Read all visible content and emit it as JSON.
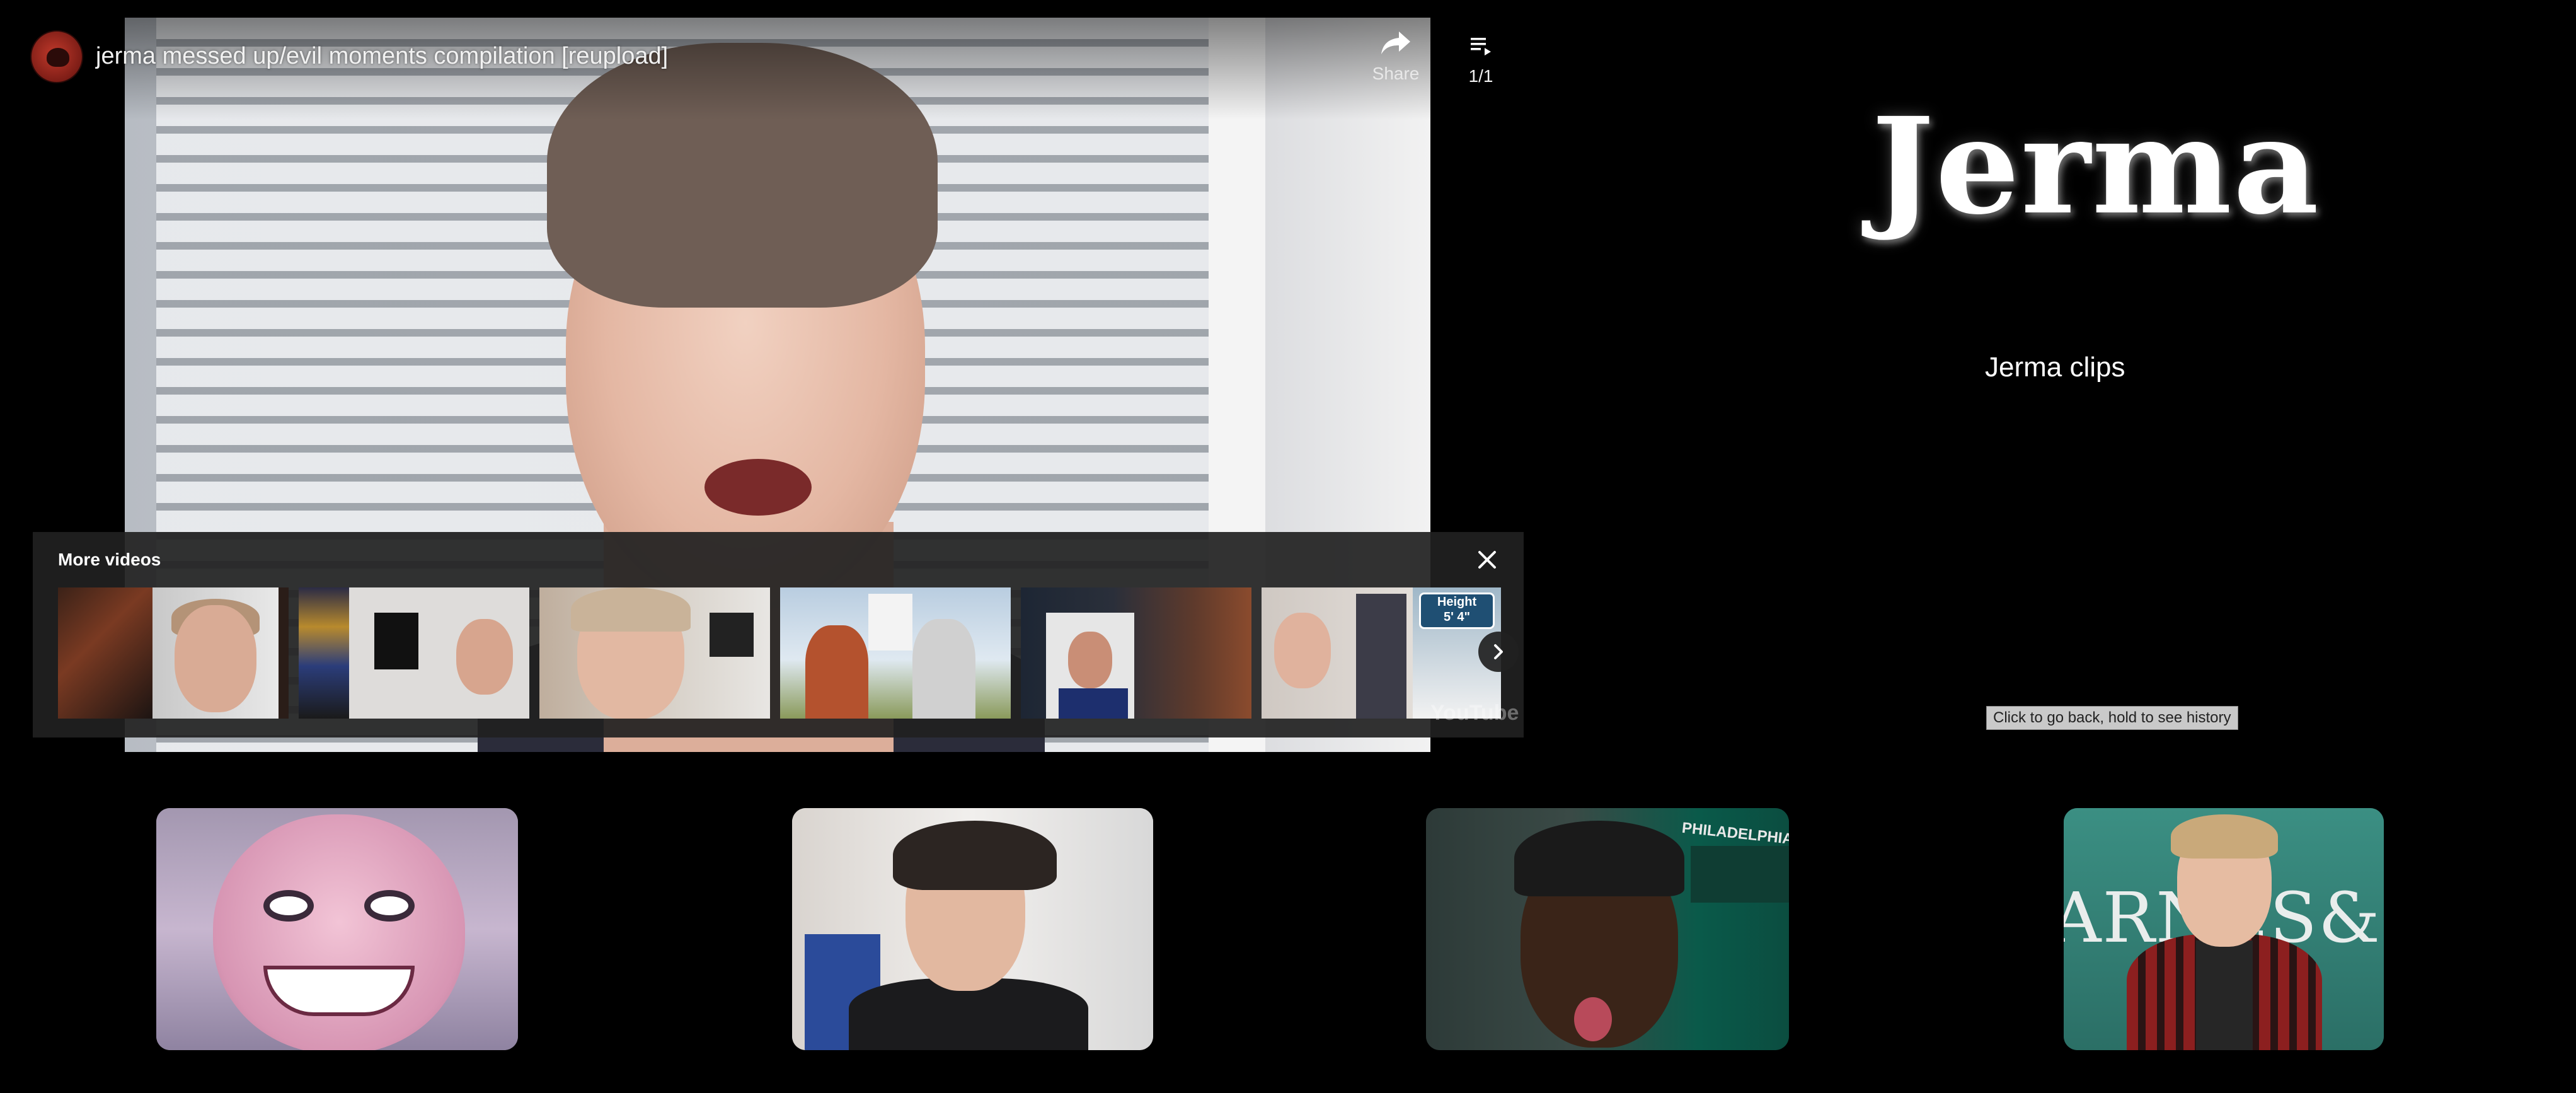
{
  "player": {
    "video_title": "jerma messed up/evil moments compilation [reupload]",
    "channel_avatar_icon": "channel-avatar-icon",
    "share_label": "Share",
    "share_icon": "share-arrow-icon",
    "playlist_icon": "playlist-icon",
    "playlist_count": "1/1",
    "watermark": "YouTube"
  },
  "more_videos": {
    "title": "More videos",
    "close_icon": "close-icon",
    "next_icon": "chevron-right-icon",
    "thumbnails": [
      {
        "id": "thumb-1"
      },
      {
        "id": "thumb-2"
      },
      {
        "id": "thumb-3"
      },
      {
        "id": "thumb-4"
      },
      {
        "id": "thumb-5"
      },
      {
        "id": "thumb-6",
        "badge_line1": "Height",
        "badge_line2": "5' 4\""
      }
    ]
  },
  "page": {
    "heading": "Jerma",
    "subtitle": "Jerma clips",
    "back_tooltip": "Click to go back, hold to see history"
  },
  "cards": [
    {
      "id": "card-jerma"
    },
    {
      "id": "card-xqc"
    },
    {
      "id": "card-eagles",
      "banner": "PHILADELPHIA EAGLES TERRITORY"
    },
    {
      "id": "card-pewdiepie",
      "sign": "ARNES&NOI"
    }
  ],
  "colors": {
    "background": "#000000",
    "overlay": "#212121",
    "text": "#ffffff",
    "tooltip_bg": "#c9c9c9"
  }
}
